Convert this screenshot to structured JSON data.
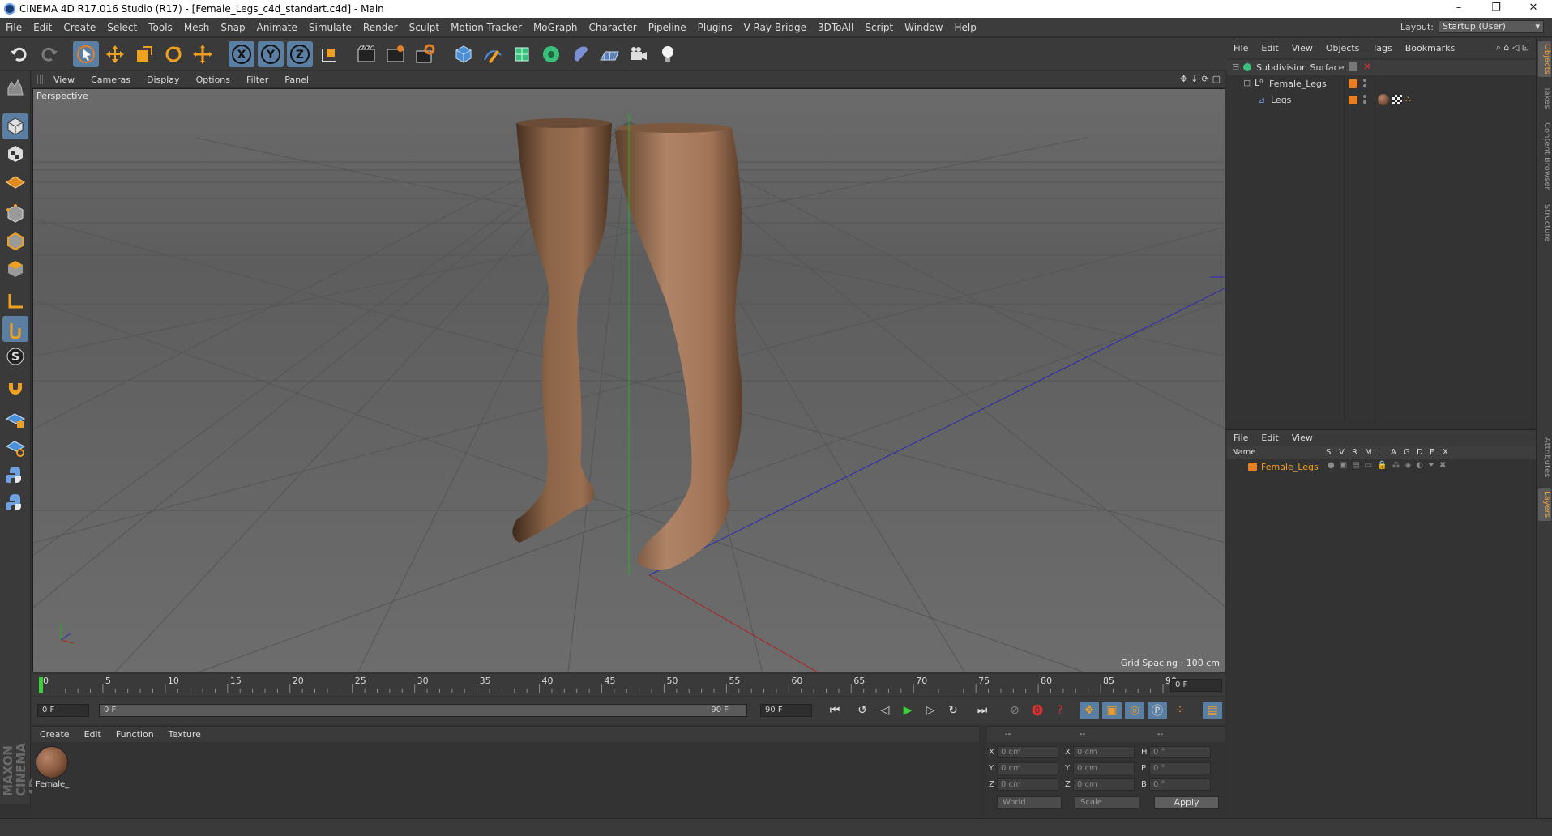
{
  "window": {
    "title": "CINEMA 4D R17.016 Studio (R17) - [Female_Legs_c4d_standart.c4d] - Main",
    "minimize": "–",
    "restore": "❐",
    "close": "✕"
  },
  "menubar": {
    "items": [
      "File",
      "Edit",
      "Create",
      "Select",
      "Tools",
      "Mesh",
      "Snap",
      "Animate",
      "Simulate",
      "Render",
      "Sculpt",
      "Motion Tracker",
      "MoGraph",
      "Character",
      "Pipeline",
      "Plugins",
      "V-Ray Bridge",
      "3DToAll",
      "Script",
      "Window",
      "Help"
    ],
    "layout_label": "Layout:",
    "layout_value": "Startup (User)"
  },
  "viewport": {
    "menu": [
      "View",
      "Cameras",
      "Display",
      "Options",
      "Filter",
      "Panel"
    ],
    "label": "Perspective",
    "grid_spacing": "Grid Spacing : 100 cm"
  },
  "timeline": {
    "ticks": [
      "0",
      "5",
      "10",
      "15",
      "20",
      "25",
      "30",
      "35",
      "40",
      "45",
      "50",
      "55",
      "60",
      "65",
      "70",
      "75",
      "80",
      "85",
      "90"
    ],
    "current_frame": "0 F",
    "start_frame": "0 F",
    "range_start": "0 F",
    "range_end": "90 F",
    "end_frame": "90 F"
  },
  "material_manager": {
    "menu": [
      "Create",
      "Edit",
      "Function",
      "Texture"
    ],
    "materials": [
      "Female_"
    ]
  },
  "coordinates": {
    "header": [
      "--",
      "--",
      "--"
    ],
    "rows": [
      {
        "a": "X",
        "av": "0 cm",
        "b": "X",
        "bv": "0 cm",
        "c": "H",
        "cv": "0 °"
      },
      {
        "a": "Y",
        "av": "0 cm",
        "b": "Y",
        "bv": "0 cm",
        "c": "P",
        "cv": "0 °"
      },
      {
        "a": "Z",
        "av": "0 cm",
        "b": "Z",
        "bv": "0 cm",
        "c": "B",
        "cv": "0 °"
      }
    ],
    "mode1": "World",
    "mode2": "Scale",
    "apply": "Apply"
  },
  "object_manager": {
    "menu": [
      "File",
      "Edit",
      "View",
      "Objects",
      "Tags",
      "Bookmarks"
    ],
    "objects": [
      {
        "name": "Subdivision Surface"
      },
      {
        "name": "Female_Legs"
      },
      {
        "name": "Legs"
      }
    ]
  },
  "layer_manager": {
    "menu": [
      "File",
      "Edit",
      "View"
    ],
    "columns": [
      "Name",
      "S",
      "V",
      "R",
      "M",
      "L",
      "A",
      "G",
      "D",
      "E",
      "X"
    ],
    "layers": [
      {
        "name": "Female_Legs"
      }
    ]
  },
  "side_tabs": [
    "Objects",
    "Takes",
    "Content Browser",
    "Structure",
    "Attributes",
    "Layers"
  ],
  "brand": "MAXON CINEMA 4D",
  "colors": {
    "accent": "#5b7ea3",
    "layer_orange": "#e67e22"
  }
}
